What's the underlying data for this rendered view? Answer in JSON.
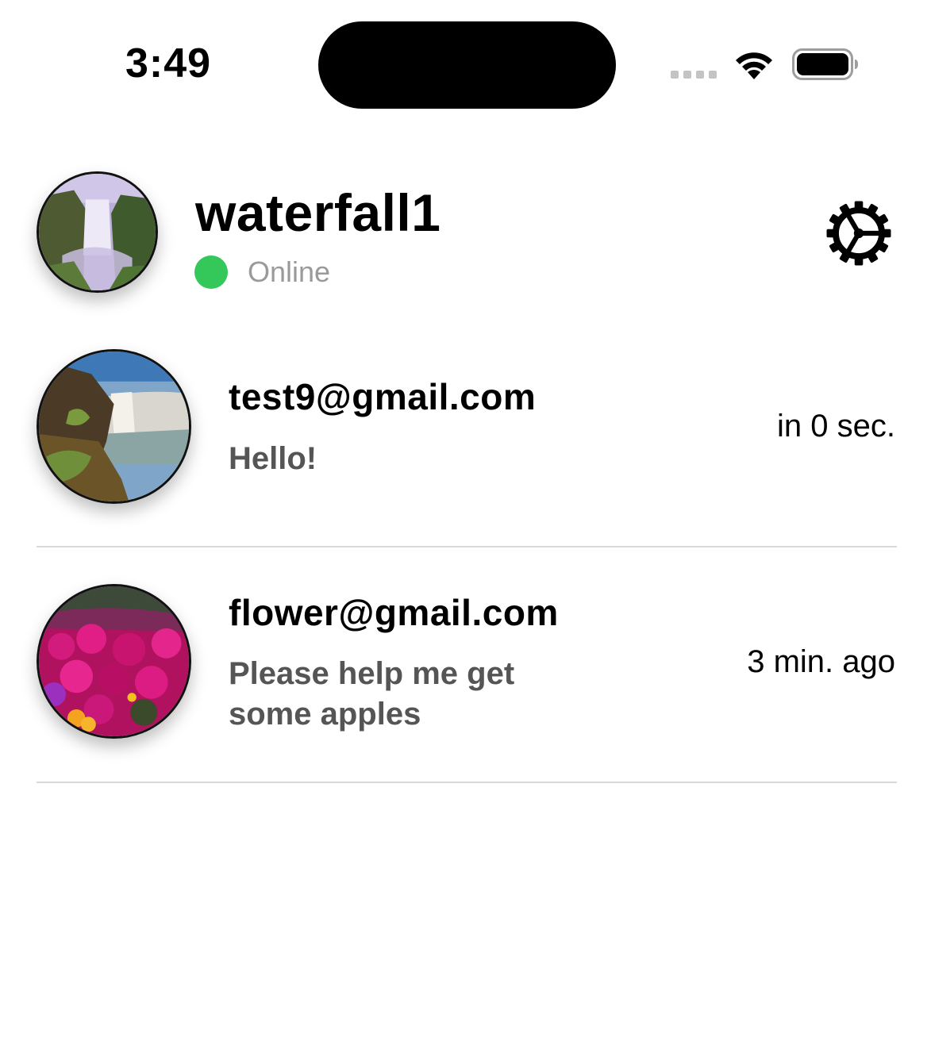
{
  "status_bar": {
    "time": "3:49",
    "icons": [
      "signal-dots-icon",
      "wifi-icon",
      "battery-icon"
    ]
  },
  "profile": {
    "name": "waterfall1",
    "status": "Online",
    "status_color": "#34c759",
    "avatar": "waterfall-photo",
    "settings_icon": "gear-icon"
  },
  "conversations": [
    {
      "title": "test9@gmail.com",
      "last_message": "Hello!",
      "time": "in 0 sec.",
      "avatar": "waterfall-canyon-photo"
    },
    {
      "title": "flower@gmail.com",
      "last_message": "Please help me get some apples",
      "time": "3 min. ago",
      "avatar": "pink-flowers-photo"
    }
  ],
  "colors": {
    "primary_text": "#000000",
    "secondary_text": "#555555",
    "muted_text": "#9a9a9a",
    "divider": "#d9d9d9",
    "online": "#34c759"
  }
}
